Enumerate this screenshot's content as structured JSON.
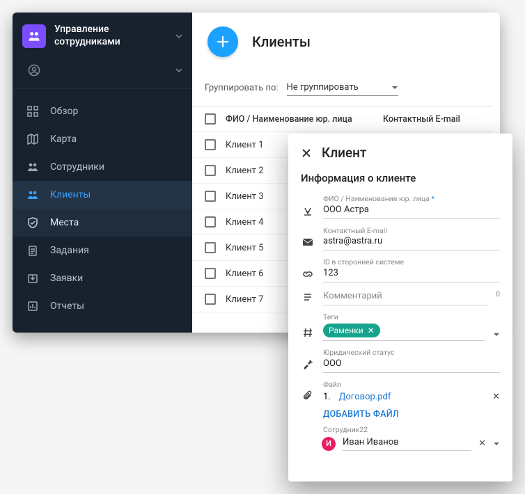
{
  "sidebar": {
    "app_title": "Управление сотрудниками",
    "items": [
      {
        "label": "Обзор"
      },
      {
        "label": "Карта"
      },
      {
        "label": "Сотрудники"
      },
      {
        "label": "Клиенты"
      },
      {
        "label": "Места"
      },
      {
        "label": "Задания"
      },
      {
        "label": "Заявки"
      },
      {
        "label": "Отчеты"
      }
    ]
  },
  "main": {
    "title": "Клиенты",
    "group_by_label": "Группировать по:",
    "group_by_value": "Не группировать",
    "columns": {
      "name": "ФИО / Наименование юр. лица",
      "email": "Контактный E-mail"
    },
    "rows": [
      {
        "name": "Клиент 1"
      },
      {
        "name": "Клиент 2"
      },
      {
        "name": "Клиент 3"
      },
      {
        "name": "Клиент 4"
      },
      {
        "name": "Клиент 5"
      },
      {
        "name": "Клиент 6"
      },
      {
        "name": "Клиент 7"
      }
    ]
  },
  "detail": {
    "title": "Клиент",
    "section": "Информация о клиенте",
    "fields": {
      "name": {
        "label": "ФИО / Наименование юр. лица",
        "value": "ООО Астра",
        "required_mark": "*"
      },
      "email": {
        "label": "Контактный E-mail",
        "value": "astra@astra.ru"
      },
      "ext_id": {
        "label": "ID в сторонней системе",
        "value": "123"
      },
      "comment": {
        "label": "Комментарий",
        "value": "",
        "counter": "0"
      },
      "tags": {
        "label": "Теги",
        "chip": "Раменки"
      },
      "legal": {
        "label": "Юридический статус",
        "value": "ООО"
      },
      "file": {
        "label": "Файл",
        "num": "1.",
        "link": "Договор.pdf"
      },
      "add_file": "ДОБАВИТЬ ФАЙЛ",
      "employee": {
        "label": "Сотрудник22",
        "initial": "И",
        "name": "Иван Иванов"
      }
    }
  }
}
